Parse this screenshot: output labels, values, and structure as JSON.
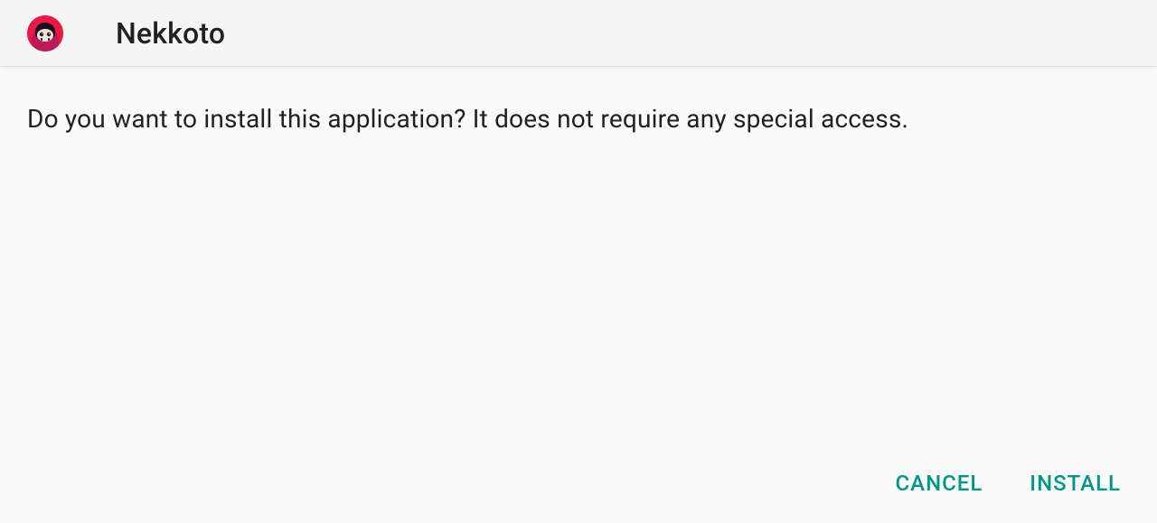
{
  "header": {
    "app_name": "Nekkoto",
    "icon_name": "nekkoto-app-icon"
  },
  "content": {
    "message": "Do you want to install this application? It does not require any special access."
  },
  "footer": {
    "cancel_label": "CANCEL",
    "install_label": "INSTALL"
  },
  "colors": {
    "accent": "#009688",
    "icon_primary": "#EC1846",
    "icon_secondary": "#8B1E6E",
    "text": "#212121",
    "header_bg": "#f5f5f5",
    "body_bg": "#fafafa"
  }
}
